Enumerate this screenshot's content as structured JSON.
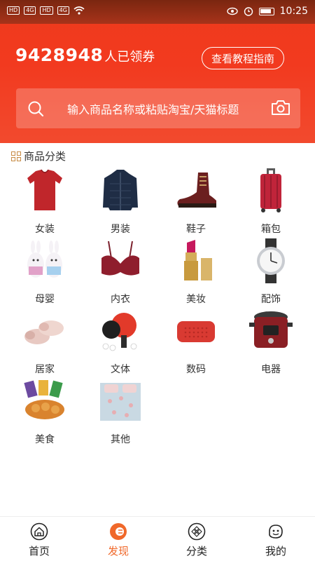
{
  "status_bar": {
    "chip1": "HD",
    "chip2": "4G",
    "chip3": "HD",
    "chip4": "4G",
    "time": "10:25"
  },
  "header": {
    "claim_count": "9428948",
    "claim_suffix": "人已领券",
    "guide_button": "查看教程指南"
  },
  "search": {
    "placeholder": "输入商品名称或粘贴淘宝/天猫标题"
  },
  "section": {
    "title": "商品分类"
  },
  "categories": [
    {
      "label": "女装"
    },
    {
      "label": "男装"
    },
    {
      "label": "鞋子"
    },
    {
      "label": "箱包"
    },
    {
      "label": "母婴"
    },
    {
      "label": "内衣"
    },
    {
      "label": "美妆"
    },
    {
      "label": "配饰"
    },
    {
      "label": "居家"
    },
    {
      "label": "文体"
    },
    {
      "label": "数码"
    },
    {
      "label": "电器"
    },
    {
      "label": "美食"
    },
    {
      "label": "其他"
    }
  ],
  "tabs": [
    {
      "label": "首页"
    },
    {
      "label": "发现"
    },
    {
      "label": "分类"
    },
    {
      "label": "我的"
    }
  ],
  "colors": {
    "accent": "#f23a1f",
    "active_tab": "#f0682a",
    "section_icon": "#c78a43"
  }
}
